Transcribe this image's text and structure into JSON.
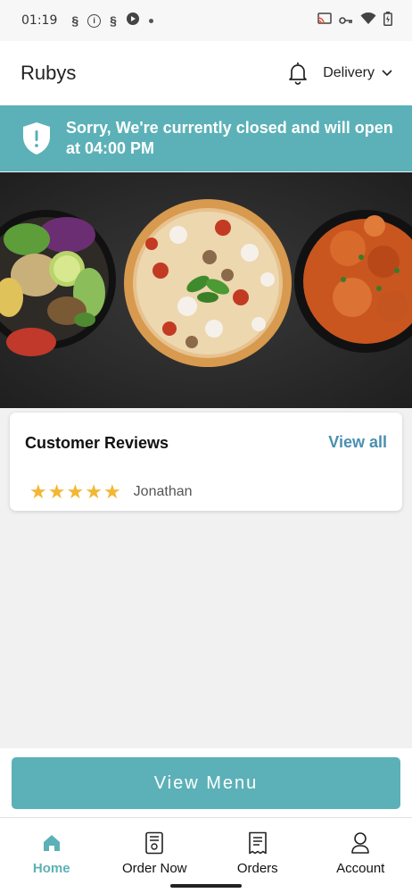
{
  "status_bar": {
    "time": "01:19",
    "left_icons": [
      "s-app-icon",
      "info-icon",
      "s-app-icon",
      "play-circle-icon",
      "dot-icon"
    ],
    "right_icons": [
      "cast-icon",
      "vpn-key-icon",
      "wifi-icon",
      "battery-icon"
    ]
  },
  "header": {
    "title": "Rubys",
    "bell_icon": "bell-icon",
    "delivery_label": "Delivery"
  },
  "banner": {
    "icon": "shield-alert-icon",
    "message": "Sorry, We're currently closed and will open at 04:00 PM",
    "color": "#5bb1b7"
  },
  "reviews": {
    "title": "Customer Reviews",
    "view_all": "View all",
    "items": [
      {
        "rating": 5,
        "reviewer": "Jonathan"
      }
    ]
  },
  "view_menu_label": "View Menu",
  "nav": {
    "items": [
      {
        "label": "Home",
        "icon": "home-icon",
        "active": true
      },
      {
        "label": "Order Now",
        "icon": "menu-book-icon",
        "active": false
      },
      {
        "label": "Orders",
        "icon": "receipt-icon",
        "active": false
      },
      {
        "label": "Account",
        "icon": "person-icon",
        "active": false
      }
    ]
  },
  "colors": {
    "accent": "#5bb1b7",
    "link": "#4a8fb0",
    "star": "#f2b734"
  }
}
